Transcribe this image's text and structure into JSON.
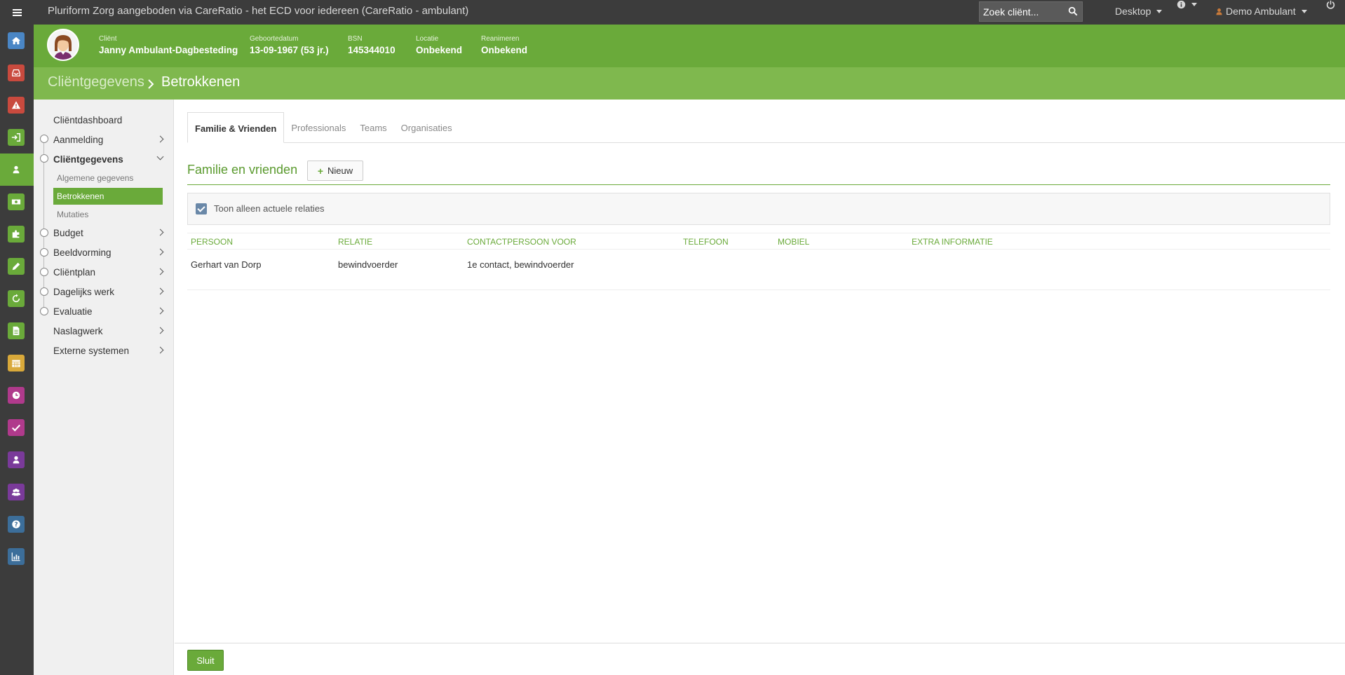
{
  "topbar": {
    "title": "Pluriform Zorg aangeboden via CareRatio - het ECD voor iedereen  (CareRatio - ambulant)",
    "search_placeholder": "Zoek cliënt...",
    "desktop_label": "Desktop",
    "user_label": "Demo Ambulant"
  },
  "rail": {
    "icons": [
      {
        "name": "home-icon",
        "color": "#4a86c5"
      },
      {
        "name": "inbox-icon",
        "color": "#c94a3e"
      },
      {
        "name": "warning-icon",
        "color": "#c94a3e"
      },
      {
        "name": "sign-in-icon",
        "color": "#6aaa3a"
      },
      {
        "name": "client-icon",
        "color": "#6aaa3a"
      },
      {
        "name": "money-icon",
        "color": "#6aaa3a"
      },
      {
        "name": "puzzle-icon",
        "color": "#6aaa3a"
      },
      {
        "name": "pencil-icon",
        "color": "#6aaa3a"
      },
      {
        "name": "refresh-icon",
        "color": "#6aaa3a"
      },
      {
        "name": "document-icon",
        "color": "#6aaa3a"
      },
      {
        "name": "calendar-icon",
        "color": "#d9a93a"
      },
      {
        "name": "clock-icon",
        "color": "#b03a8c"
      },
      {
        "name": "check-icon",
        "color": "#b03a8c"
      },
      {
        "name": "user-icon",
        "color": "#7a3a9a"
      },
      {
        "name": "users-icon",
        "color": "#7a3a9a"
      },
      {
        "name": "help-icon",
        "color": "#3c6e9a"
      },
      {
        "name": "chart-icon",
        "color": "#3c6e9a"
      }
    ]
  },
  "client": {
    "client_label": "Cliënt",
    "client_value": "Janny Ambulant-Dagbesteding",
    "dob_label": "Geboortedatum",
    "dob_value": "13-09-1967 (53 jr.)",
    "bsn_label": "BSN",
    "bsn_value": "145344010",
    "location_label": "Locatie",
    "location_value": "Onbekend",
    "resus_label": "Reanimeren",
    "resus_value": "Onbekend"
  },
  "breadcrumb": {
    "parent": "Cliëntgegevens",
    "current": "Betrokkenen"
  },
  "sidebar": {
    "items": [
      {
        "label": "Cliëntdashboard"
      },
      {
        "label": "Aanmelding"
      },
      {
        "label": "Cliëntgegevens"
      },
      {
        "label": "Budget"
      },
      {
        "label": "Beeldvorming"
      },
      {
        "label": "Cliëntplan"
      },
      {
        "label": "Dagelijks werk"
      },
      {
        "label": "Evaluatie"
      },
      {
        "label": "Naslagwerk"
      },
      {
        "label": "Externe systemen"
      }
    ],
    "subitems": [
      {
        "label": "Algemene gegevens"
      },
      {
        "label": "Betrokkenen"
      },
      {
        "label": "Mutaties"
      }
    ]
  },
  "tabs": [
    {
      "label": "Familie & Vrienden"
    },
    {
      "label": "Professionals"
    },
    {
      "label": "Teams"
    },
    {
      "label": "Organisaties"
    }
  ],
  "section": {
    "title": "Familie en vrienden",
    "new_button": "Nieuw",
    "filter_label": "Toon alleen actuele relaties",
    "filter_checked": true
  },
  "table": {
    "headers": [
      "Persoon",
      "Relatie",
      "Contactpersoon voor",
      "Telefoon",
      "Mobiel",
      "Extra informatie"
    ],
    "rows": [
      [
        "Gerhart van Dorp",
        "bewindvoerder",
        "1e contact, bewindvoerder",
        "",
        "",
        ""
      ]
    ]
  },
  "footer": {
    "close_button": "Sluit"
  },
  "colors": {
    "brand_green": "#6aaa3a",
    "breadcrumb_green": "#7fb84e",
    "dark_bar": "#3c3c3c"
  }
}
